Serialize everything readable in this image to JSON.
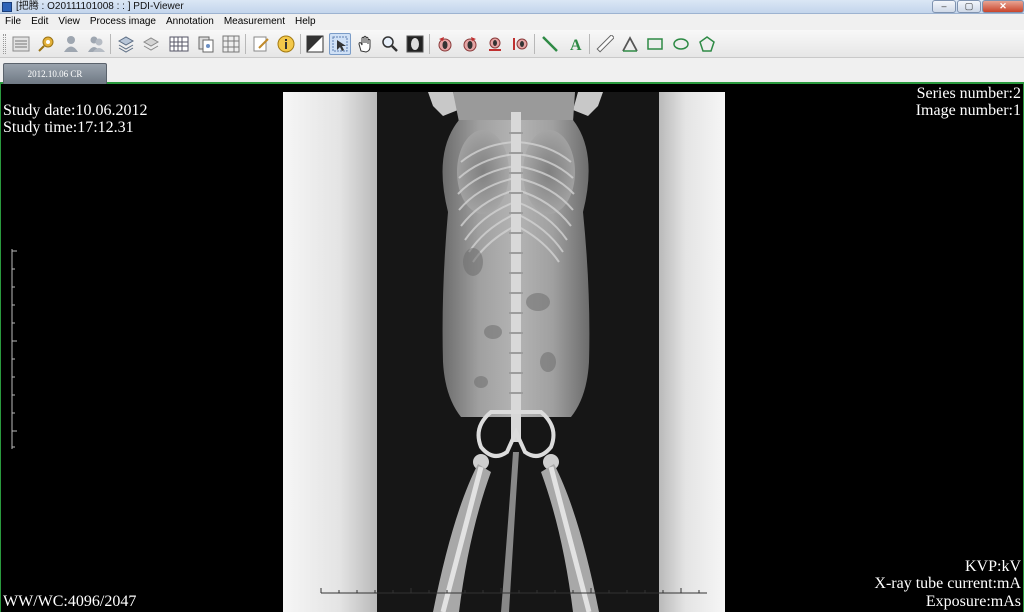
{
  "window": {
    "title": "[把腾 : O20111101008 : : ] PDI-Viewer",
    "minimize_label": "–",
    "maximize_label": "▢",
    "close_label": "✕"
  },
  "menu": {
    "items": [
      "File",
      "Edit",
      "View",
      "Process image",
      "Annotation",
      "Measurement",
      "Help"
    ]
  },
  "toolbar": {
    "tools": [
      "list-icon",
      "key-icon",
      "user-icon",
      "user-group-icon",
      "layers-icon",
      "stack-icon",
      "grid-layout-icon",
      "copy-images-icon",
      "grid-icon",
      "edit-icon",
      "info-icon",
      "window-level-icon",
      "select-pointer-icon",
      "pan-hand-icon",
      "zoom-icon",
      "invert-icon",
      "rotate-left-icon",
      "rotate-right-icon",
      "flip-horizontal-icon",
      "flip-vertical-icon",
      "line-measure-icon",
      "text-annotation-icon",
      "ruler-icon",
      "angle-icon",
      "rectangle-icon",
      "ellipse-icon",
      "polygon-icon"
    ],
    "active_tool": "select-pointer-icon",
    "accent_color": "#7a9cc8"
  },
  "tabs": [
    {
      "label": "2012.10.06 CR",
      "active": true
    }
  ],
  "viewer": {
    "study_date": "Study date:10.06.2012",
    "study_time": "Study time:17:12.31",
    "series_number": "Series number:2",
    "image_number": "Image number:1",
    "ww_wc": "WW/WC:4096/2047",
    "kvp": "KVP:kV",
    "tube_current": "X-ray tube current:mA",
    "exposure": "Exposure:mAs",
    "image_description": "radiograph-dog-ventrodorsal"
  },
  "colors": {
    "frame_green": "#2a9a3e",
    "viewer_background": "#000000",
    "overlay_text": "#ffffff"
  }
}
